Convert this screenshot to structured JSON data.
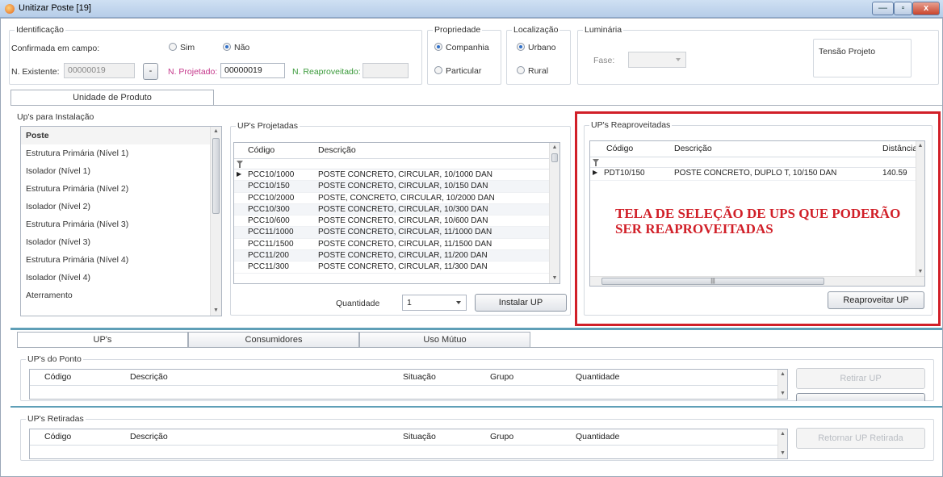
{
  "window": {
    "title": "Unitizar Poste [19]",
    "controls": [
      "—",
      "▫",
      "x"
    ]
  },
  "identificacao": {
    "group_title": "Identificação",
    "confirmada_label": "Confirmada em campo:",
    "sim_label": "Sim",
    "nao_label": "Não",
    "n_existente_label": "N. Existente:",
    "n_existente_value": "00000019",
    "minus_button": "-",
    "n_projetado_label": "N. Projetado:",
    "n_projetado_value": "00000019",
    "n_reaproveitado_label": "N. Reaproveitado:",
    "n_reaproveitado_value": ""
  },
  "propriedade": {
    "group_title": "Propriedade",
    "companhia": "Companhia",
    "particular": "Particular"
  },
  "localizacao": {
    "group_title": "Localização",
    "urbano": "Urbano",
    "rural": "Rural"
  },
  "luminaria": {
    "group_title": "Luminária",
    "fase_label": "Fase:",
    "fase_value": "",
    "tensao_label": "Tensão Projeto"
  },
  "top_tab": {
    "label": "Unidade de Produto"
  },
  "ups_instalacao": {
    "title": "Up's para Instalação",
    "items": [
      "Poste",
      "Estrutura Primária (Nível 1)",
      "Isolador (Nível 1)",
      "Estrutura Primária (Nível 2)",
      "Isolador (Nível 2)",
      "Estrutura Primária (Nível 3)",
      "Isolador (Nível 3)",
      "Estrutura Primária (Nível 4)",
      "Isolador (Nível 4)",
      "Aterramento"
    ]
  },
  "ups_projetadas": {
    "title": "UP's Projetadas",
    "col_codigo": "Código",
    "col_descricao": "Descrição",
    "rows": [
      {
        "codigo": "PCC10/1000",
        "descricao": "POSTE CONCRETO, CIRCULAR, 10/1000 DAN"
      },
      {
        "codigo": "PCC10/150",
        "descricao": "POSTE CONCRETO, CIRCULAR, 10/150 DAN"
      },
      {
        "codigo": "PCC10/2000",
        "descricao": "POSTE, CONCRETO, CIRCULAR, 10/2000 DAN"
      },
      {
        "codigo": "PCC10/300",
        "descricao": "POSTE CONCRETO, CIRCULAR, 10/300 DAN"
      },
      {
        "codigo": "PCC10/600",
        "descricao": "POSTE CONCRETO, CIRCULAR, 10/600 DAN"
      },
      {
        "codigo": "PCC11/1000",
        "descricao": "POSTE CONCRETO, CIRCULAR, 11/1000 DAN"
      },
      {
        "codigo": "PCC11/1500",
        "descricao": "POSTE CONCRETO, CIRCULAR, 11/1500 DAN"
      },
      {
        "codigo": "PCC11/200",
        "descricao": "POSTE CONCRETO, CIRCULAR, 11/200 DAN"
      },
      {
        "codigo": "PCC11/300",
        "descricao": "POSTE CONCRETO, CIRCULAR, 11/300 DAN"
      }
    ],
    "quantidade_label": "Quantidade",
    "quantidade_value": "1",
    "instalar_button": "Instalar UP"
  },
  "ups_reaproveitadas": {
    "title": "UP's Reaproveitadas",
    "col_codigo": "Código",
    "col_descricao": "Descrição",
    "col_distancia": "Distância",
    "rows": [
      {
        "codigo": "PDT10/150",
        "descricao": "POSTE CONCRETO, DUPLO T, 10/150 DAN",
        "distancia": "140.59"
      }
    ],
    "annotation_line1": "TELA DE SELEÇÃO DE UPS QUE PODERÃO",
    "annotation_line2": "SER REAPROVEITADAS",
    "reaproveitar_button": "Reaproveitar UP"
  },
  "bottom_tabs": [
    "UP's",
    "Consumidores",
    "Uso Mútuo"
  ],
  "ups_ponto": {
    "title": "UP's do Ponto",
    "columns": [
      "Código",
      "Descrição",
      "Situação",
      "Grupo",
      "Quantidade"
    ],
    "retirar_button": "Retirar UP"
  },
  "ups_retiradas": {
    "title": "UP's Retiradas",
    "columns": [
      "Código",
      "Descrição",
      "Situação",
      "Grupo",
      "Quantidade"
    ],
    "retornar_button": "Retornar UP Retirada"
  }
}
